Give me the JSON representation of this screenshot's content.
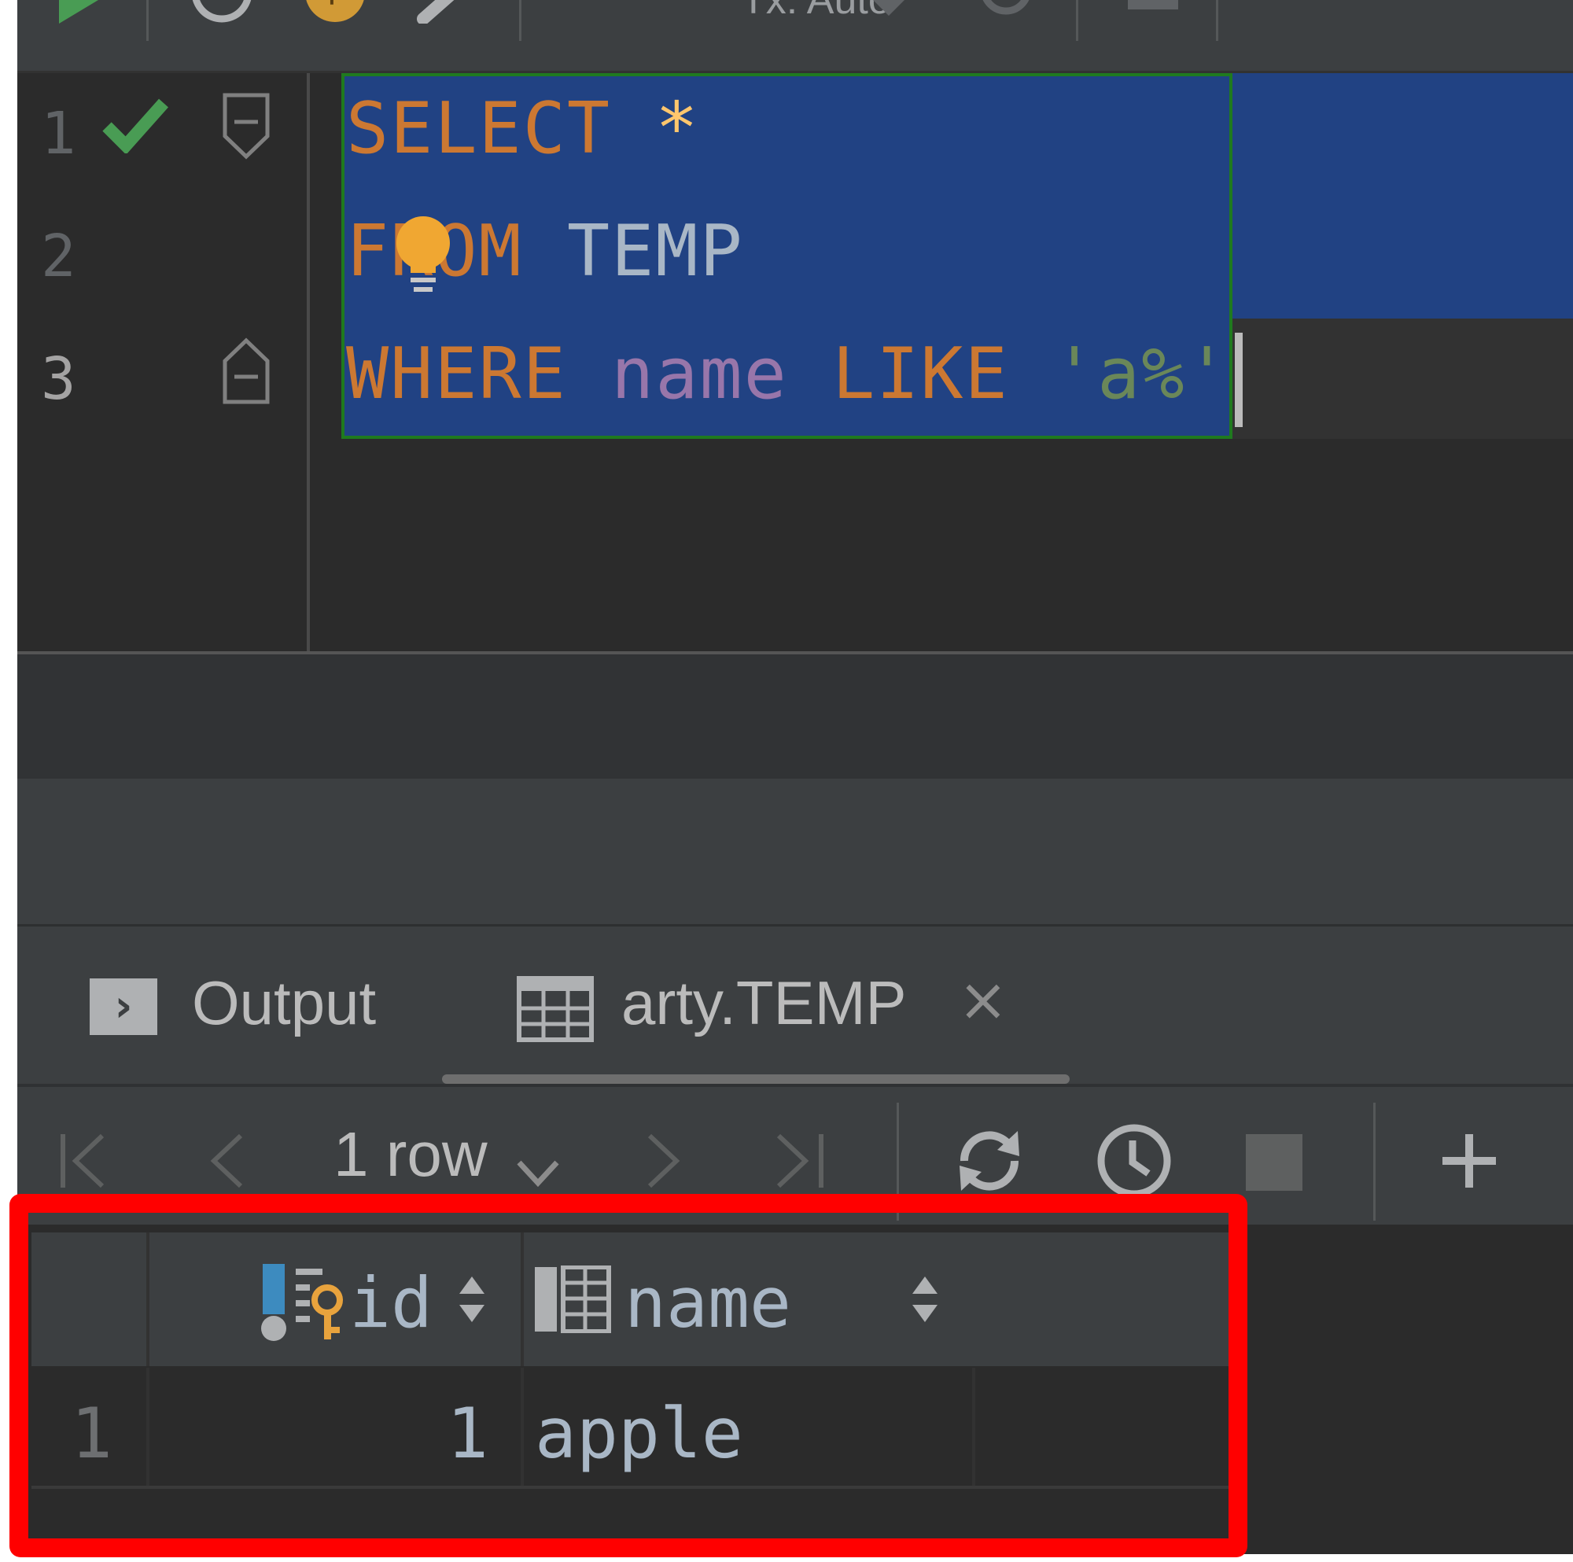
{
  "toolbar": {
    "tx_label": "Tx: Auto",
    "icons": [
      "run-icon",
      "history-icon",
      "profile-icon",
      "wrench-icon",
      "dropdown-icon",
      "commit-icon",
      "rollback-icon",
      "stop-icon"
    ]
  },
  "editor": {
    "lines": [
      {
        "number": "1",
        "status": "check-icon"
      },
      {
        "number": "2"
      },
      {
        "number": "3"
      }
    ],
    "code": {
      "line1": {
        "kw": "SELECT",
        "star": "*"
      },
      "line2": {
        "kw": "FROM",
        "table": "TEMP"
      },
      "line3": {
        "kw1": "WHERE",
        "column": "name",
        "kw2": "LIKE",
        "string": "'a%'"
      }
    },
    "colors": {
      "keyword": "#cc7832",
      "identifier": "#a9b7c6",
      "column": "#9876aa",
      "string": "#6a8759",
      "selection": "#214283"
    }
  },
  "tabs": [
    {
      "label": "Output",
      "icon": "console-icon"
    },
    {
      "label": "arty.TEMP",
      "icon": "table-icon",
      "active": true
    }
  ],
  "results": {
    "row_count_label": "1 row",
    "columns": [
      {
        "name": "id",
        "icon": "primary-key-column-icon"
      },
      {
        "name": "name",
        "icon": "column-icon"
      }
    ],
    "rows": [
      {
        "rownum": "1",
        "id": "1",
        "name": "apple"
      }
    ]
  },
  "highlight_color": "#ff0000"
}
